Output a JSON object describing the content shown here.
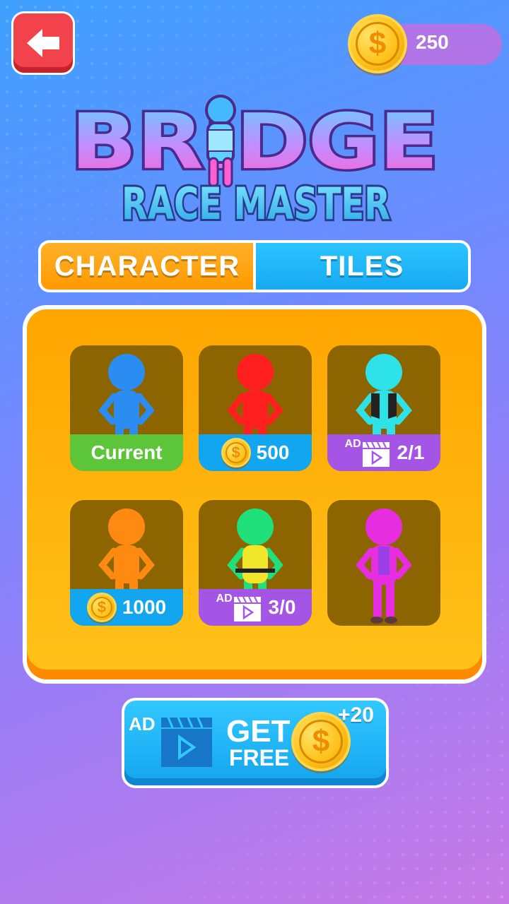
{
  "header": {
    "back_icon": "arrow-left-icon",
    "coin_icon": "dollar-coin-icon",
    "coins": "250"
  },
  "logo": {
    "title": "BRIDGE",
    "subtitle": "RACE MASTER"
  },
  "tabs": [
    {
      "label": "CHARACTER",
      "active": true,
      "color": "#ff9a00"
    },
    {
      "label": "TILES",
      "active": false,
      "color": "#17a9f2"
    }
  ],
  "characters": [
    {
      "color": "#2b8cf2",
      "status": "current",
      "label": "Current"
    },
    {
      "color": "#ff1f1f",
      "status": "price",
      "label": "500"
    },
    {
      "color": "#2ee3e8",
      "status": "ad",
      "ad_label": "AD",
      "label": "2/1"
    },
    {
      "color": "#ff8a12",
      "status": "price",
      "label": "1000"
    },
    {
      "color": "#1fe07a",
      "status": "ad",
      "ad_label": "AD",
      "label": "3/0"
    },
    {
      "color": "#e62ee0",
      "status": "locked",
      "label": ""
    }
  ],
  "free_button": {
    "ad_label": "AD",
    "get": "GET",
    "free": "FREE",
    "bonus": "+20"
  }
}
